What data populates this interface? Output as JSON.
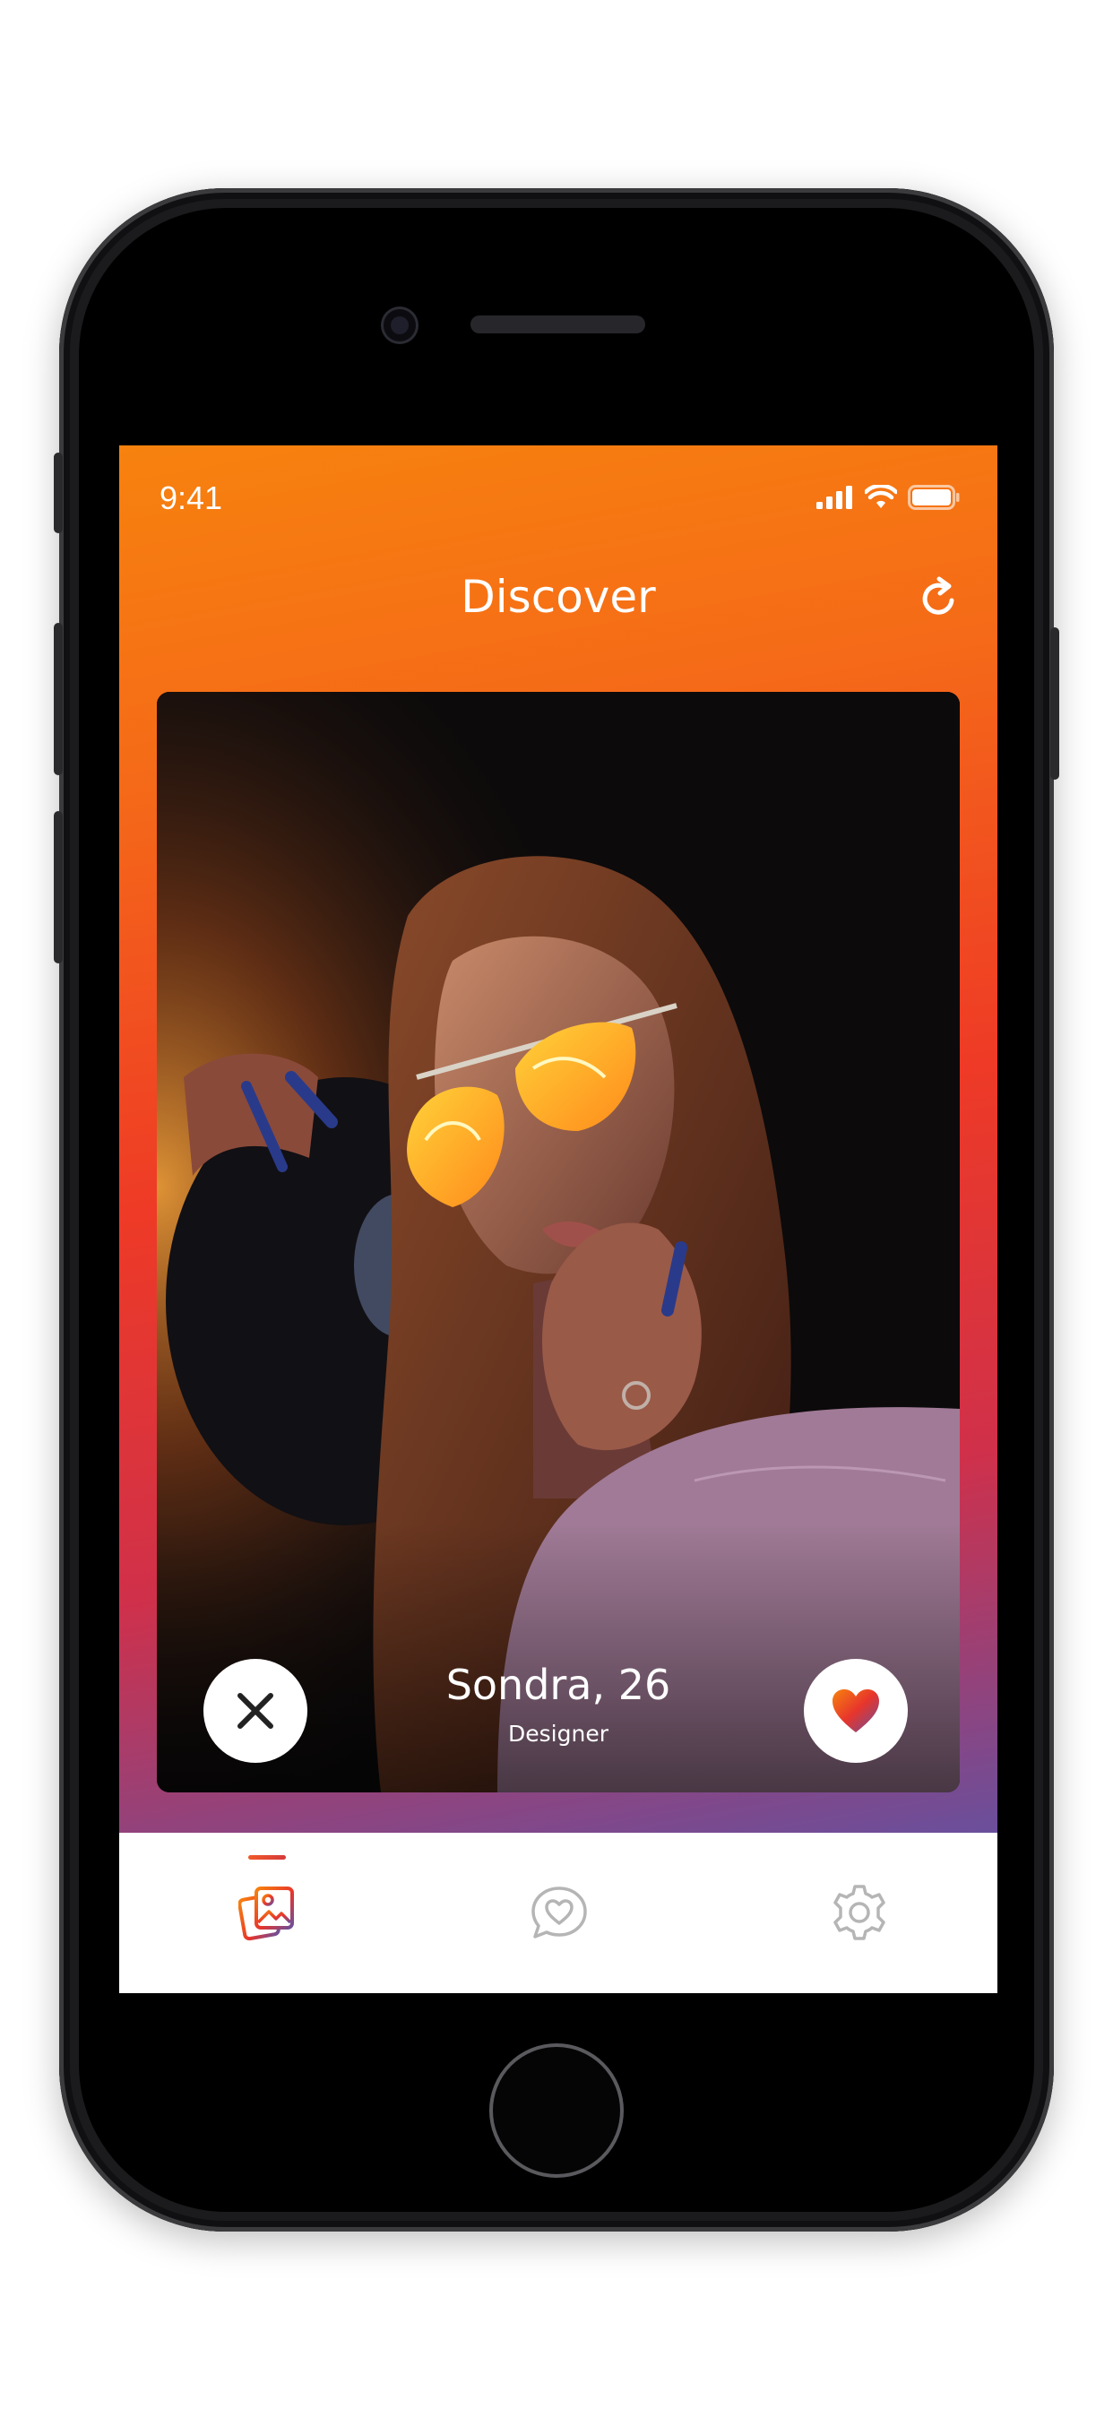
{
  "status_bar": {
    "time": "9:41"
  },
  "header": {
    "title": "Discover"
  },
  "card": {
    "name_age": "Sondra, 26",
    "occupation": "Designer"
  },
  "tabs": [
    {
      "name": "discover",
      "icon": "photos-icon",
      "active": true
    },
    {
      "name": "matches",
      "icon": "chat-heart-icon",
      "active": false
    },
    {
      "name": "settings",
      "icon": "gear-icon",
      "active": false
    }
  ],
  "colors": {
    "gradient_top": "#f7820e",
    "gradient_mid": "#ee3a26",
    "gradient_bottom": "#6a4f9c",
    "inactive_icon": "#b5b5b5"
  }
}
